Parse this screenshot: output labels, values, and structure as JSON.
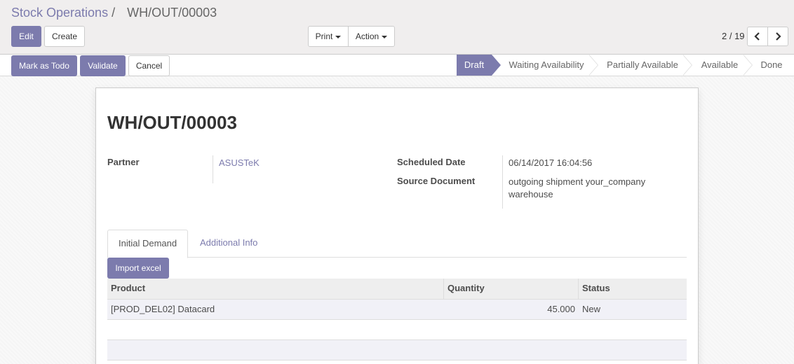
{
  "breadcrumb": {
    "parent": "Stock Operations",
    "separator": "/",
    "current": "WH/OUT/00003"
  },
  "toolbar": {
    "edit_label": "Edit",
    "create_label": "Create",
    "print_label": "Print",
    "action_label": "Action"
  },
  "pager": {
    "value": "2 / 19"
  },
  "statusbar": {
    "buttons": {
      "mark_todo": "Mark as Todo",
      "validate": "Validate",
      "cancel": "Cancel"
    },
    "stages": [
      "Draft",
      "Waiting Availability",
      "Partially Available",
      "Available",
      "Done"
    ],
    "active_stage": "Draft"
  },
  "record": {
    "title": "WH/OUT/00003",
    "partner_label": "Partner",
    "partner_value": "ASUSTeK",
    "scheduled_date_label": "Scheduled Date",
    "scheduled_date_value": "06/14/2017 16:04:56",
    "source_document_label": "Source Document",
    "source_document_line1": "outgoing shipment your_company",
    "source_document_line2": "warehouse"
  },
  "tabs": [
    "Initial Demand",
    "Additional Info"
  ],
  "import_label": "Import excel",
  "table": {
    "headers": [
      "Product",
      "Quantity",
      "Status"
    ],
    "rows": [
      {
        "product": "[PROD_DEL02] Datacard",
        "quantity": "45.000",
        "status": "New"
      }
    ]
  },
  "colors": {
    "accent": "#7c7bad",
    "control_bg": "#f0eeee",
    "sheet_bg": "#ffffff",
    "row_stripe": "#f1f1f7"
  }
}
